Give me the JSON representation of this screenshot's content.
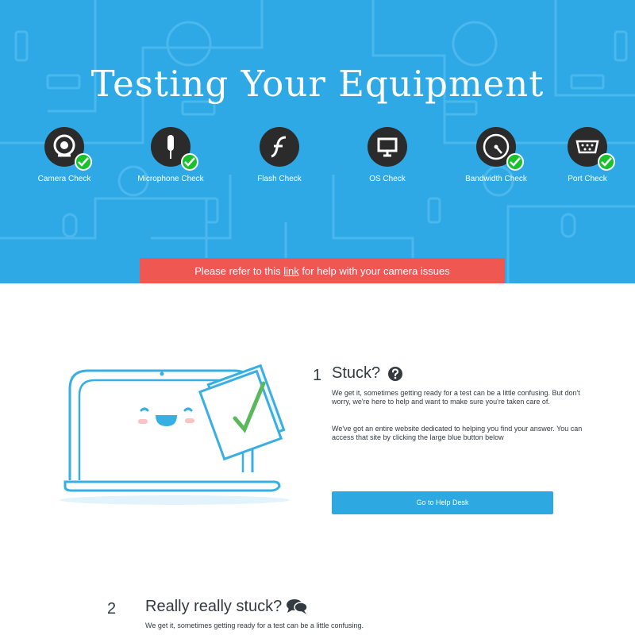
{
  "hero": {
    "title": "Testing Your Equipment",
    "background_color": "#2ea9e6",
    "checks": [
      {
        "label": "Camera Check",
        "icon": "webcam-icon",
        "passed": true
      },
      {
        "label": "Microphone Check",
        "icon": "microphone-icon",
        "passed": true
      },
      {
        "label": "Flash Check",
        "icon": "flash-icon",
        "passed": false
      },
      {
        "label": "OS Check",
        "icon": "monitor-icon",
        "passed": false
      },
      {
        "label": "Bandwidth Check",
        "icon": "speedometer-icon",
        "passed": true
      },
      {
        "label": "Port Check",
        "icon": "port-icon",
        "passed": true
      }
    ]
  },
  "alert": {
    "text_before": "Please refer to this ",
    "link_text": "link",
    "text_after": " for help with your camera issues",
    "color": "#ef5753"
  },
  "step1": {
    "number": "1",
    "title": "Stuck?",
    "icon": "question-circle-icon",
    "paragraph1": "We get it, sometimes getting ready for a test can be a little confusing. But don't worry, we're here to help and want to make sure you're taken care of.",
    "paragraph2": "We've got an entire website dedicated to helping you find your answer. You can access that site by clicking the large blue button below",
    "button_label": "Go to Help Desk",
    "button_color": "#2ea8e0"
  },
  "step2": {
    "number": "2",
    "title": "Really really stuck?",
    "icon": "chat-bubbles-icon",
    "paragraph1": "We get it, sometimes getting ready for a test can be a little confusing."
  }
}
